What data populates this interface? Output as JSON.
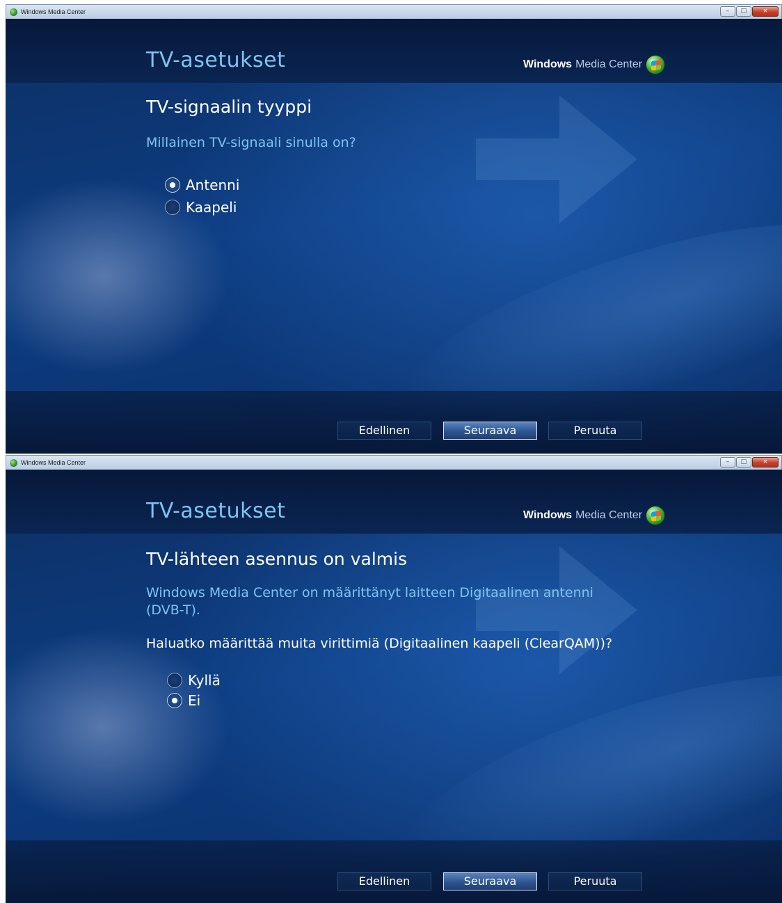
{
  "windows": [
    {
      "titlebar": {
        "title": "Windows Media Center",
        "min": "–",
        "max": "□",
        "close": "×"
      },
      "page_title": "TV-asetukset",
      "brand": {
        "part1": "Windows",
        "part2": "Media Center"
      },
      "section_title": "TV-signaalin tyyppi",
      "question": "Millainen TV-signaali sinulla on?",
      "options": [
        {
          "label": "Antenni",
          "selected": true
        },
        {
          "label": "Kaapeli",
          "selected": false
        }
      ],
      "buttons": {
        "back": "Edellinen",
        "next": "Seuraava",
        "cancel": "Peruuta"
      }
    },
    {
      "titlebar": {
        "title": "Windows Media Center",
        "min": "–",
        "max": "□",
        "close": "×"
      },
      "page_title": "TV-asetukset",
      "brand": {
        "part1": "Windows",
        "part2": "Media Center"
      },
      "section_title": "TV-lähteen asennus on valmis",
      "info_line1": "Windows Media Center on määrittänyt laitteen Digitaalinen antenni",
      "info_line2": "(DVB-T).",
      "question": "Haluatko määrittää muita virittimiä (Digitaalinen kaapeli (ClearQAM))?",
      "options": [
        {
          "label": "Kyllä",
          "selected": false
        },
        {
          "label": "Ei",
          "selected": true
        }
      ],
      "buttons": {
        "back": "Edellinen",
        "next": "Seuraava",
        "cancel": "Peruuta"
      }
    }
  ],
  "colors": {
    "accent": "#7ec4f0",
    "background": "#0d3d82",
    "header": "#07183a"
  }
}
